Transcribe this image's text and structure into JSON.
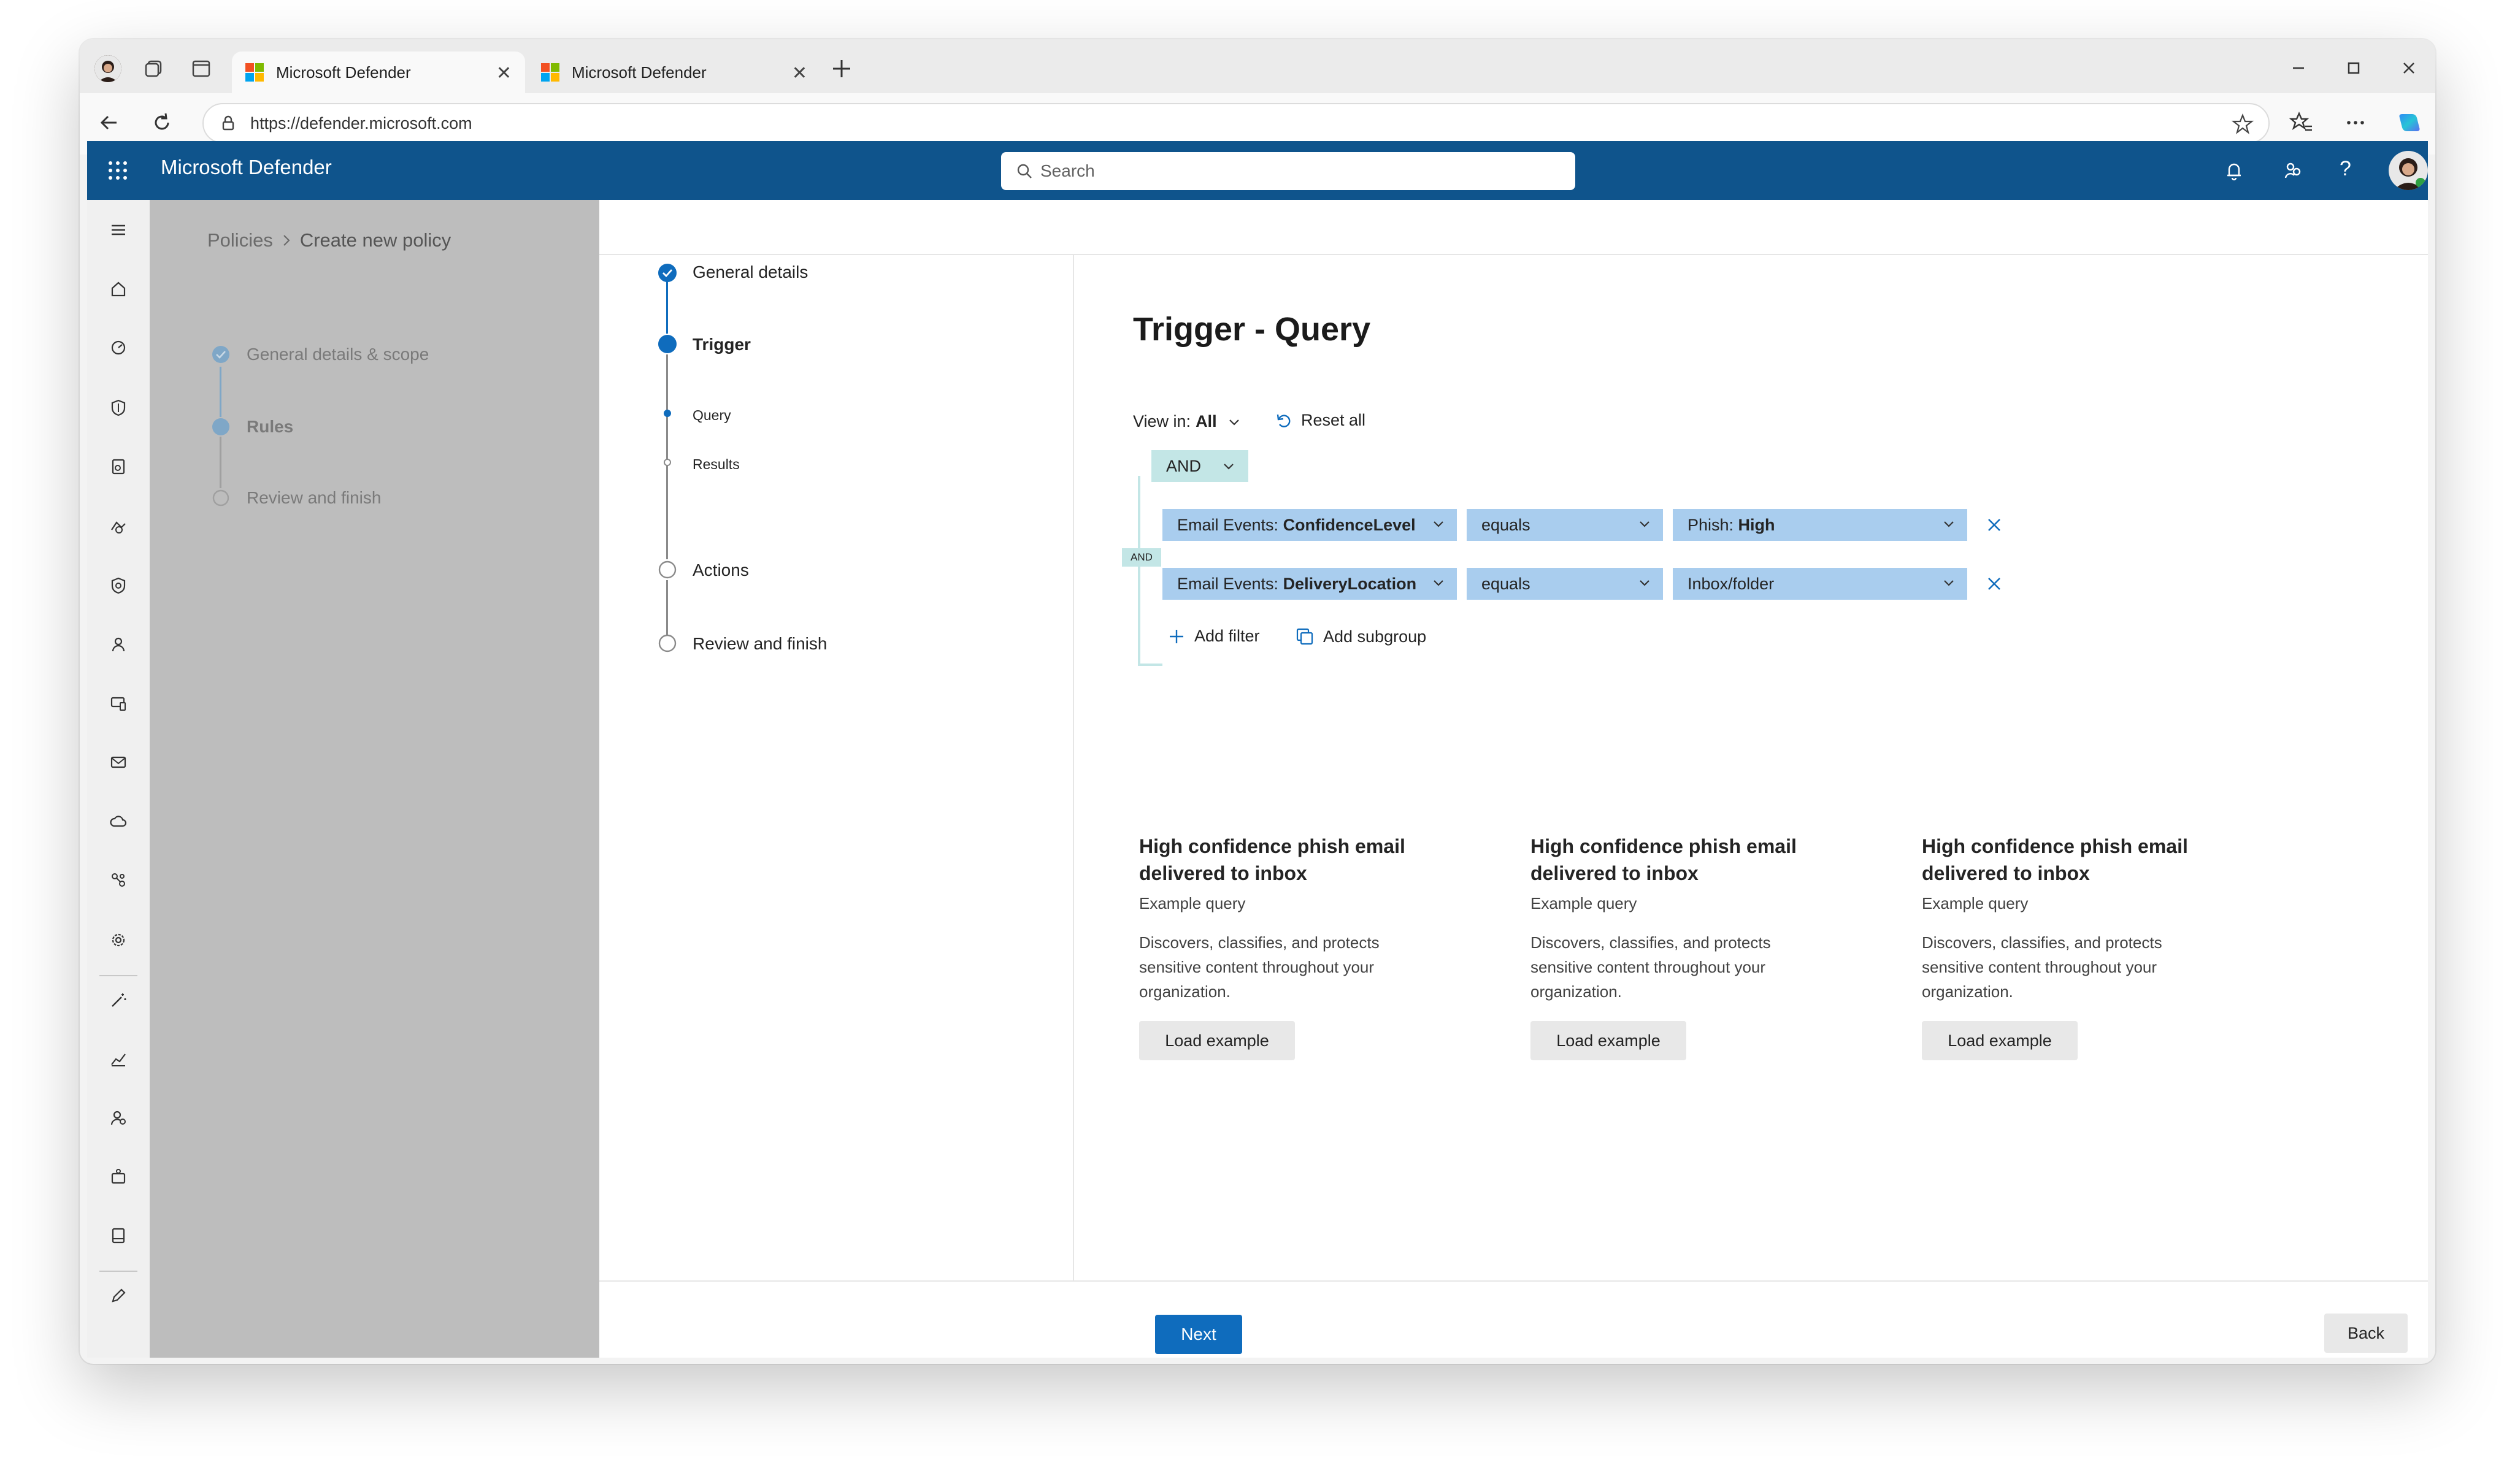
{
  "browser": {
    "tabs": [
      {
        "title": "Microsoft Defender",
        "active": true
      },
      {
        "title": "Microsoft Defender",
        "active": false
      }
    ],
    "url": "https://defender.microsoft.com"
  },
  "app": {
    "title": "Microsoft Defender",
    "search_placeholder": "Search",
    "header_color": "#0f548c"
  },
  "background_wizard": {
    "breadcrumb": [
      "Policies",
      "Create new policy"
    ],
    "steps": [
      {
        "label": "General details & scope",
        "state": "completed"
      },
      {
        "label": "Rules",
        "state": "current"
      },
      {
        "label": "Review and finish",
        "state": "pending"
      }
    ]
  },
  "wizard": {
    "steps": [
      {
        "label": "General details",
        "state": "completed"
      },
      {
        "label": "Trigger",
        "state": "current"
      },
      {
        "label": "Query",
        "state": "current-substep"
      },
      {
        "label": "Results",
        "state": "pending-substep"
      },
      {
        "label": "Actions",
        "state": "pending"
      },
      {
        "label": "Review and finish",
        "state": "pending"
      }
    ]
  },
  "query": {
    "title": "Trigger - Query",
    "view_in_label": "View in:",
    "view_in_value": "All",
    "reset_label": "Reset all",
    "group_operator": "AND",
    "connector_label": "AND",
    "filters": [
      {
        "field_prefix": "Email Events: ",
        "field": "ConfidenceLevel",
        "operator": "equals",
        "value_prefix": "Phish: ",
        "value": "High"
      },
      {
        "field_prefix": "Email Events: ",
        "field": "DeliveryLocation",
        "operator": "equals",
        "value_prefix": "",
        "value": "Inbox/folder"
      }
    ],
    "add_filter_label": "Add filter",
    "add_subgroup_label": "Add subgroup"
  },
  "examples": [
    {
      "title": "High confidence phish email delivered to inbox",
      "subtitle": "Example query",
      "description": "Discovers, classifies, and protects sensitive content throughout your organization.",
      "button": "Load example"
    },
    {
      "title": "High confidence phish email delivered to inbox",
      "subtitle": "Example query",
      "description": "Discovers, classifies, and protects sensitive content throughout your organization.",
      "button": "Load example"
    },
    {
      "title": "High confidence phish email delivered to inbox",
      "subtitle": "Example query",
      "description": "Discovers, classifies, and protects sensitive content throughout your organization.",
      "button": "Load example"
    }
  ],
  "footer": {
    "next_label": "Next",
    "back_label": "Back"
  },
  "colors": {
    "accent": "#0f6cbd",
    "dropdown_fill": "#a9cdee",
    "operator_fill": "#c3e6e6"
  }
}
